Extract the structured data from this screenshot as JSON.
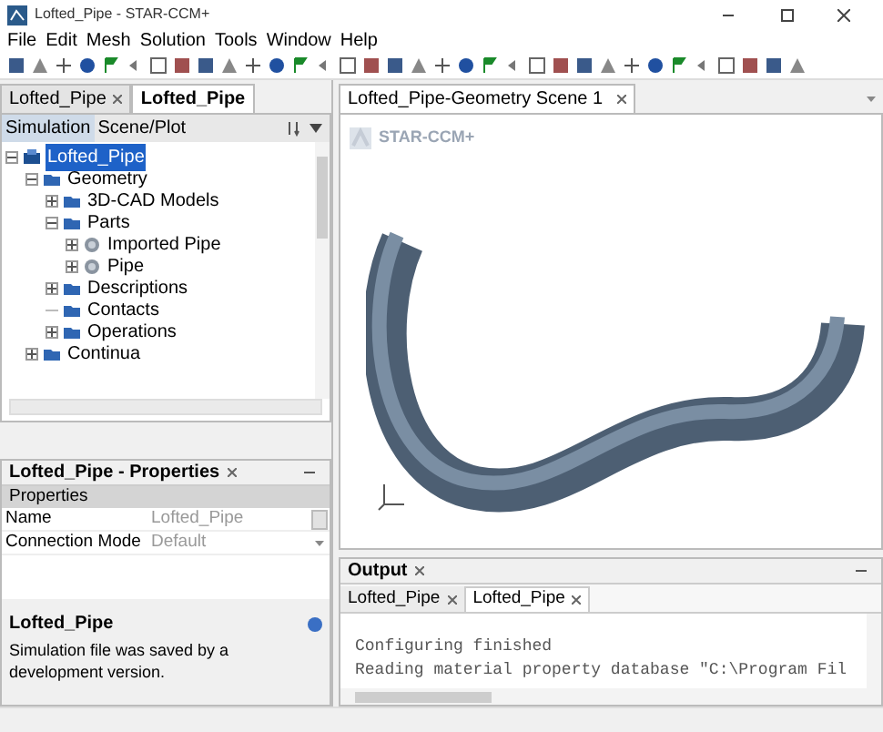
{
  "window": {
    "title": "Lofted_Pipe - STAR-CCM+"
  },
  "menu": [
    "File",
    "Edit",
    "Mesh",
    "Solution",
    "Tools",
    "Window",
    "Help"
  ],
  "editor_tabs": [
    {
      "label": "Lofted_Pipe",
      "selected": false,
      "closable": true
    },
    {
      "label": "Lofted_Pipe",
      "selected": true,
      "closable": false
    }
  ],
  "explorer_tabs": [
    {
      "label": "Simulation",
      "selected": true
    },
    {
      "label": "Scene/Plot",
      "selected": false
    }
  ],
  "tree": [
    {
      "label": "Lofted_Pipe",
      "selected": true,
      "expanded": true,
      "kind": "simulation",
      "children": [
        {
          "label": "Geometry",
          "selected": false,
          "expanded": true,
          "kind": "folder",
          "children": [
            {
              "label": "3D-CAD Models",
              "selected": false,
              "expanded": false,
              "kind": "folder"
            },
            {
              "label": "Parts",
              "selected": false,
              "expanded": true,
              "kind": "folder",
              "children": [
                {
                  "label": "Imported Pipe",
                  "selected": false,
                  "expanded": false,
                  "kind": "part"
                },
                {
                  "label": "Pipe",
                  "selected": false,
                  "expanded": false,
                  "kind": "part"
                }
              ]
            },
            {
              "label": "Descriptions",
              "selected": false,
              "expanded": false,
              "kind": "folder"
            },
            {
              "label": "Contacts",
              "selected": false,
              "kind": "folder"
            },
            {
              "label": "Operations",
              "selected": false,
              "expanded": false,
              "kind": "folder"
            }
          ]
        },
        {
          "label": "Continua",
          "selected": false,
          "expanded": false,
          "kind": "folder"
        }
      ]
    }
  ],
  "properties": {
    "title": "Lofted_Pipe - Properties",
    "group": "Properties",
    "rows": [
      {
        "name": "Name",
        "value": "Lofted_Pipe",
        "kind": "ellipsis"
      },
      {
        "name": "Connection Mode",
        "value": "Default",
        "kind": "dropdown"
      }
    ]
  },
  "description": {
    "title": "Lofted_Pipe",
    "text": "Simulation file was saved by a development version."
  },
  "scene": {
    "tab": "Lofted_Pipe-Geometry Scene 1",
    "logo": "STAR-CCM+"
  },
  "output": {
    "title": "Output",
    "tabs": [
      {
        "label": "Lofted_Pipe",
        "selected": false
      },
      {
        "label": "Lofted_Pipe",
        "selected": true
      }
    ],
    "lines": [
      "Configuring finished",
      "Reading material property database \"C:\\Program Fil"
    ]
  }
}
